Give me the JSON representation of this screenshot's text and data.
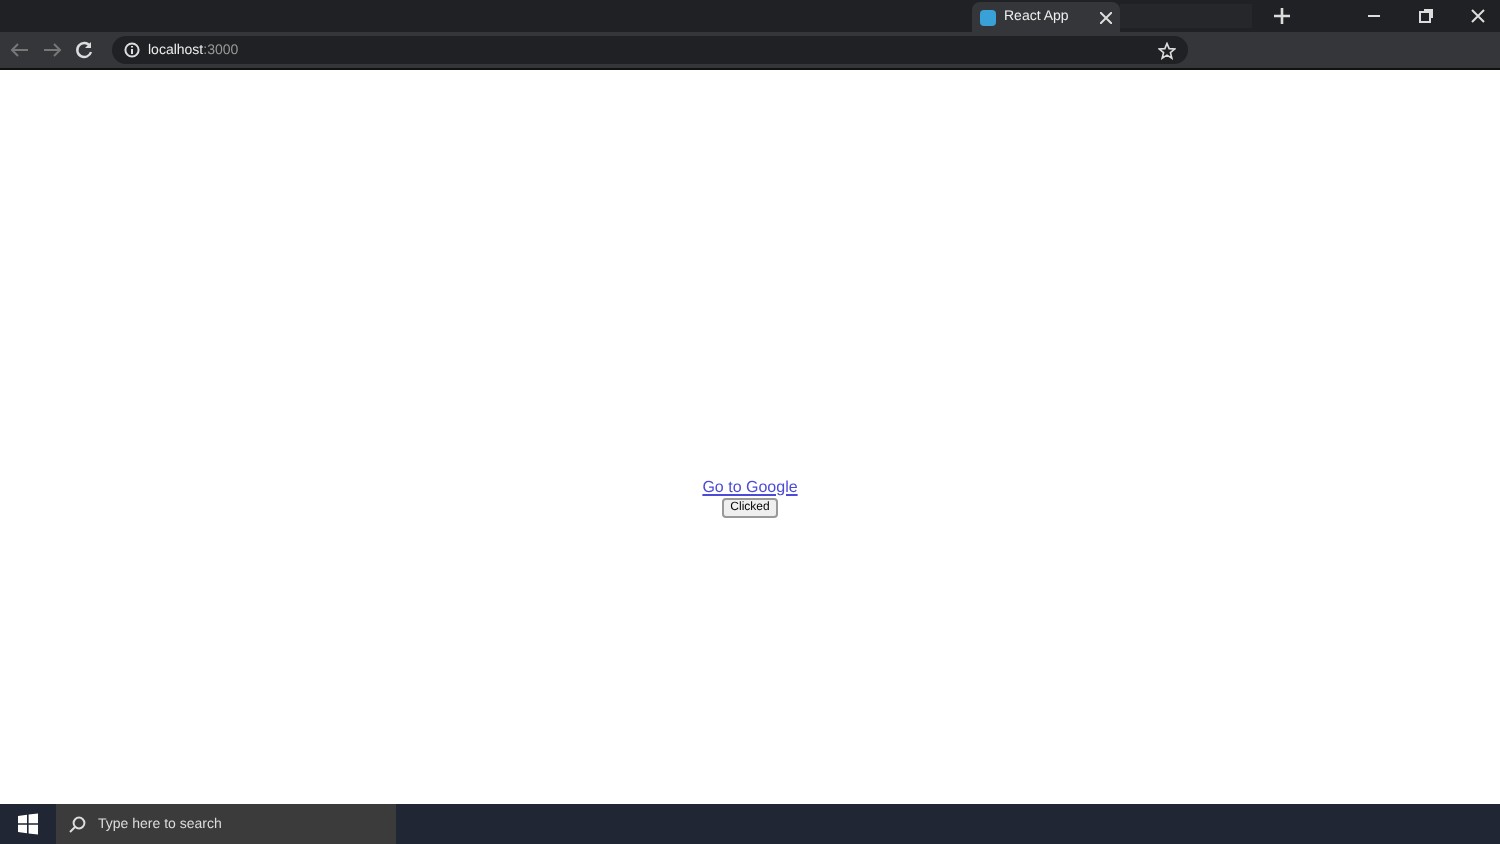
{
  "browser": {
    "tab": {
      "title": "React App",
      "selected": true
    },
    "address_bar": {
      "host": "localhost",
      "port": ":3000"
    }
  },
  "page": {
    "link": "Go to Google",
    "button": "Clicked"
  },
  "taskbar": {
    "search_placeholder": "Type here to search"
  }
}
